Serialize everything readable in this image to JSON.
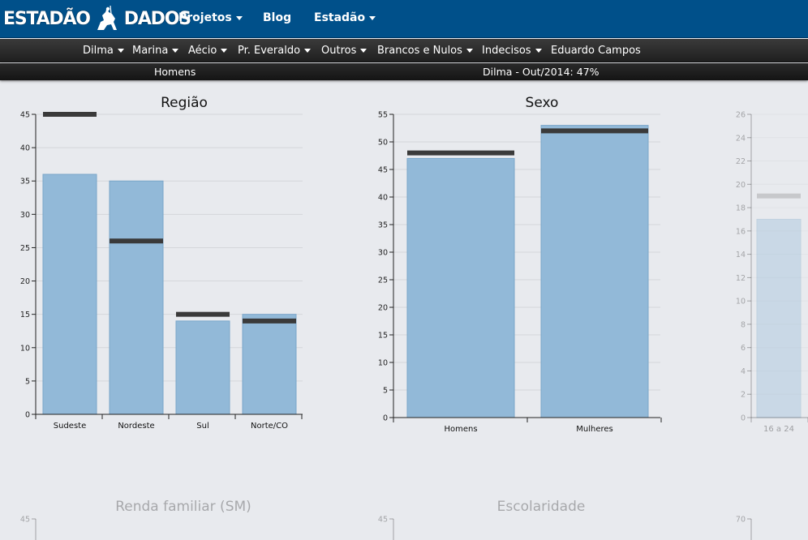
{
  "brand": {
    "left": "ESTADÃO",
    "right": "DADOS"
  },
  "topnav": [
    {
      "label": "Projetos",
      "dropdown": true
    },
    {
      "label": "Blog",
      "dropdown": false
    },
    {
      "label": "Estadão",
      "dropdown": true
    }
  ],
  "subnav": [
    {
      "label": "Dilma",
      "dropdown": true
    },
    {
      "label": "Marina",
      "dropdown": true
    },
    {
      "label": "Aécio",
      "dropdown": true
    },
    {
      "label": "Pr. Everaldo",
      "dropdown": true
    },
    {
      "label": "Outros",
      "dropdown": true
    },
    {
      "label": "Brancos e Nulos",
      "dropdown": true
    },
    {
      "label": "Indecisos",
      "dropdown": true
    },
    {
      "label": "Eduardo Campos",
      "dropdown": false
    }
  ],
  "info": {
    "filter": "Homens",
    "status": "Dilma - Out/2014: 47%"
  },
  "colors": {
    "topbar": "#00508a",
    "bar": "#92b9d8",
    "marker": "#3a3a3a"
  },
  "chart_data": [
    {
      "type": "bar",
      "title": "Região",
      "categories": [
        "Sudeste",
        "Nordeste",
        "Sul",
        "Norte/CO"
      ],
      "values": [
        36,
        35,
        14,
        15
      ],
      "markers": [
        45,
        26,
        15,
        14
      ],
      "ylim": [
        0,
        45
      ],
      "yticks": [
        0,
        5,
        10,
        15,
        20,
        25,
        30,
        35,
        40,
        45
      ],
      "grid": true
    },
    {
      "type": "bar",
      "title": "Sexo",
      "categories": [
        "Homens",
        "Mulheres"
      ],
      "values": [
        47,
        53
      ],
      "markers": [
        48,
        52
      ],
      "ylim": [
        0,
        55
      ],
      "yticks": [
        0,
        5,
        10,
        15,
        20,
        25,
        30,
        35,
        40,
        45,
        50,
        55
      ],
      "grid": true
    },
    {
      "type": "bar",
      "title": "",
      "faded": true,
      "categories": [
        "16 a 24"
      ],
      "values": [
        17
      ],
      "markers": [
        19
      ],
      "ylim": [
        0,
        26
      ],
      "yticks": [
        0,
        2,
        4,
        6,
        8,
        10,
        12,
        14,
        16,
        18,
        20,
        22,
        24,
        26
      ],
      "grid": true
    },
    {
      "type": "bar",
      "title": "Renda familiar (SM)",
      "faded": true,
      "categories": [],
      "values": [],
      "markers": [],
      "ylim": [
        0,
        45
      ],
      "yticks": [
        45
      ],
      "grid": false
    },
    {
      "type": "bar",
      "title": "Escolaridade",
      "faded": true,
      "categories": [],
      "values": [],
      "markers": [],
      "ylim": [
        0,
        45
      ],
      "yticks": [
        45
      ],
      "grid": false
    },
    {
      "type": "bar",
      "title": "",
      "faded": true,
      "categories": [],
      "values": [],
      "markers": [],
      "ylim": [
        0,
        70
      ],
      "yticks": [
        70
      ],
      "grid": false
    }
  ]
}
